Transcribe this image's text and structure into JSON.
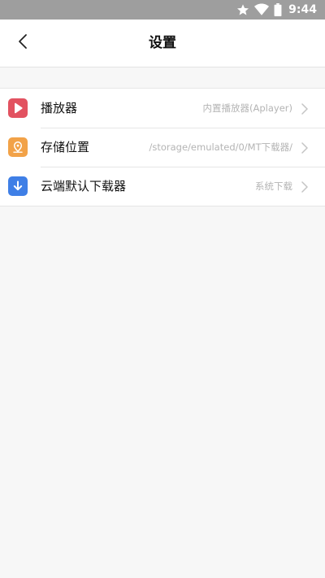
{
  "status_bar": {
    "time": "9:44",
    "icons": [
      "star-icon",
      "wifi-icon",
      "battery-icon"
    ]
  },
  "header": {
    "title": "设置",
    "back_icon": "chevron-left-icon"
  },
  "settings": {
    "items": [
      {
        "label": "播放器",
        "value": "内置播放器(Aplayer)",
        "icon": "play-icon",
        "icon_color": "#e25260"
      },
      {
        "label": "存储位置",
        "value": "/storage/emulated/0/MT下载器/",
        "icon": "location-pin-icon",
        "icon_color": "#f2a248"
      },
      {
        "label": "云端默认下载器",
        "value": "系统下载",
        "icon": "download-arrow-icon",
        "icon_color": "#3f7fe6"
      }
    ]
  },
  "colors": {
    "status_bar": "#9e9e9e",
    "background": "#f7f7f7",
    "card": "#ffffff",
    "secondary_text": "#b4b4b4"
  }
}
